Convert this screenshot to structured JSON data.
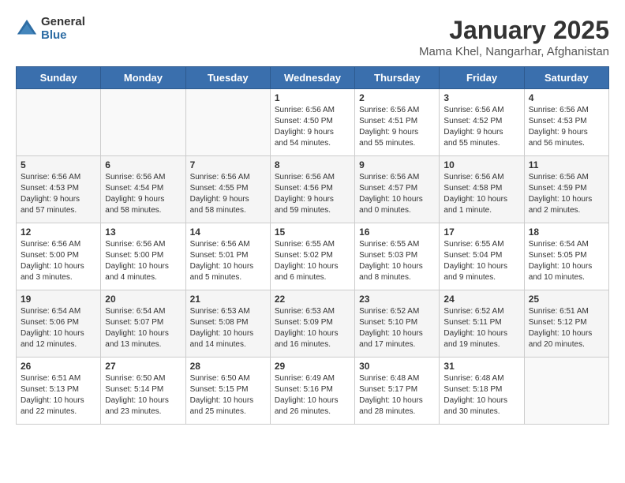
{
  "header": {
    "logo_general": "General",
    "logo_blue": "Blue",
    "title": "January 2025",
    "subtitle": "Mama Khel, Nangarhar, Afghanistan"
  },
  "days_of_week": [
    "Sunday",
    "Monday",
    "Tuesday",
    "Wednesday",
    "Thursday",
    "Friday",
    "Saturday"
  ],
  "weeks": [
    [
      {
        "day": "",
        "info": ""
      },
      {
        "day": "",
        "info": ""
      },
      {
        "day": "",
        "info": ""
      },
      {
        "day": "1",
        "info": "Sunrise: 6:56 AM\nSunset: 4:50 PM\nDaylight: 9 hours\nand 54 minutes."
      },
      {
        "day": "2",
        "info": "Sunrise: 6:56 AM\nSunset: 4:51 PM\nDaylight: 9 hours\nand 55 minutes."
      },
      {
        "day": "3",
        "info": "Sunrise: 6:56 AM\nSunset: 4:52 PM\nDaylight: 9 hours\nand 55 minutes."
      },
      {
        "day": "4",
        "info": "Sunrise: 6:56 AM\nSunset: 4:53 PM\nDaylight: 9 hours\nand 56 minutes."
      }
    ],
    [
      {
        "day": "5",
        "info": "Sunrise: 6:56 AM\nSunset: 4:53 PM\nDaylight: 9 hours\nand 57 minutes."
      },
      {
        "day": "6",
        "info": "Sunrise: 6:56 AM\nSunset: 4:54 PM\nDaylight: 9 hours\nand 58 minutes."
      },
      {
        "day": "7",
        "info": "Sunrise: 6:56 AM\nSunset: 4:55 PM\nDaylight: 9 hours\nand 58 minutes."
      },
      {
        "day": "8",
        "info": "Sunrise: 6:56 AM\nSunset: 4:56 PM\nDaylight: 9 hours\nand 59 minutes."
      },
      {
        "day": "9",
        "info": "Sunrise: 6:56 AM\nSunset: 4:57 PM\nDaylight: 10 hours\nand 0 minutes."
      },
      {
        "day": "10",
        "info": "Sunrise: 6:56 AM\nSunset: 4:58 PM\nDaylight: 10 hours\nand 1 minute."
      },
      {
        "day": "11",
        "info": "Sunrise: 6:56 AM\nSunset: 4:59 PM\nDaylight: 10 hours\nand 2 minutes."
      }
    ],
    [
      {
        "day": "12",
        "info": "Sunrise: 6:56 AM\nSunset: 5:00 PM\nDaylight: 10 hours\nand 3 minutes."
      },
      {
        "day": "13",
        "info": "Sunrise: 6:56 AM\nSunset: 5:00 PM\nDaylight: 10 hours\nand 4 minutes."
      },
      {
        "day": "14",
        "info": "Sunrise: 6:56 AM\nSunset: 5:01 PM\nDaylight: 10 hours\nand 5 minutes."
      },
      {
        "day": "15",
        "info": "Sunrise: 6:55 AM\nSunset: 5:02 PM\nDaylight: 10 hours\nand 6 minutes."
      },
      {
        "day": "16",
        "info": "Sunrise: 6:55 AM\nSunset: 5:03 PM\nDaylight: 10 hours\nand 8 minutes."
      },
      {
        "day": "17",
        "info": "Sunrise: 6:55 AM\nSunset: 5:04 PM\nDaylight: 10 hours\nand 9 minutes."
      },
      {
        "day": "18",
        "info": "Sunrise: 6:54 AM\nSunset: 5:05 PM\nDaylight: 10 hours\nand 10 minutes."
      }
    ],
    [
      {
        "day": "19",
        "info": "Sunrise: 6:54 AM\nSunset: 5:06 PM\nDaylight: 10 hours\nand 12 minutes."
      },
      {
        "day": "20",
        "info": "Sunrise: 6:54 AM\nSunset: 5:07 PM\nDaylight: 10 hours\nand 13 minutes."
      },
      {
        "day": "21",
        "info": "Sunrise: 6:53 AM\nSunset: 5:08 PM\nDaylight: 10 hours\nand 14 minutes."
      },
      {
        "day": "22",
        "info": "Sunrise: 6:53 AM\nSunset: 5:09 PM\nDaylight: 10 hours\nand 16 minutes."
      },
      {
        "day": "23",
        "info": "Sunrise: 6:52 AM\nSunset: 5:10 PM\nDaylight: 10 hours\nand 17 minutes."
      },
      {
        "day": "24",
        "info": "Sunrise: 6:52 AM\nSunset: 5:11 PM\nDaylight: 10 hours\nand 19 minutes."
      },
      {
        "day": "25",
        "info": "Sunrise: 6:51 AM\nSunset: 5:12 PM\nDaylight: 10 hours\nand 20 minutes."
      }
    ],
    [
      {
        "day": "26",
        "info": "Sunrise: 6:51 AM\nSunset: 5:13 PM\nDaylight: 10 hours\nand 22 minutes."
      },
      {
        "day": "27",
        "info": "Sunrise: 6:50 AM\nSunset: 5:14 PM\nDaylight: 10 hours\nand 23 minutes."
      },
      {
        "day": "28",
        "info": "Sunrise: 6:50 AM\nSunset: 5:15 PM\nDaylight: 10 hours\nand 25 minutes."
      },
      {
        "day": "29",
        "info": "Sunrise: 6:49 AM\nSunset: 5:16 PM\nDaylight: 10 hours\nand 26 minutes."
      },
      {
        "day": "30",
        "info": "Sunrise: 6:48 AM\nSunset: 5:17 PM\nDaylight: 10 hours\nand 28 minutes."
      },
      {
        "day": "31",
        "info": "Sunrise: 6:48 AM\nSunset: 5:18 PM\nDaylight: 10 hours\nand 30 minutes."
      },
      {
        "day": "",
        "info": ""
      }
    ]
  ]
}
